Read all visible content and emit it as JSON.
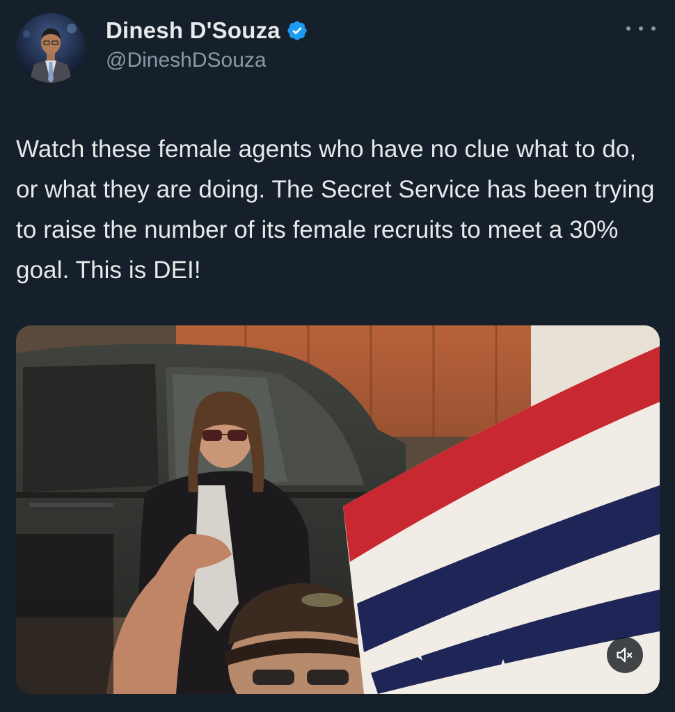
{
  "author": {
    "display_name": "Dinesh D'Souza",
    "handle": "@DineshDSouza",
    "verified": true,
    "avatar_icon": "author-avatar"
  },
  "tweet": {
    "text": "Watch these female agents who have no clue what to do, or what they are doing. The Secret Service has been trying to raise the number of its female recruits to meet a 30% goal. This is DEI!"
  },
  "media": {
    "type": "video",
    "muted": true
  },
  "icons": {
    "more": "more-horizontal-icon",
    "verified": "verified-badge-icon",
    "mute": "volume-muted-icon"
  },
  "colors": {
    "background": "#15202b",
    "primary_text": "#e7e9ea",
    "secondary_text": "#8b98a5",
    "verified_blue": "#1d9bf0"
  }
}
